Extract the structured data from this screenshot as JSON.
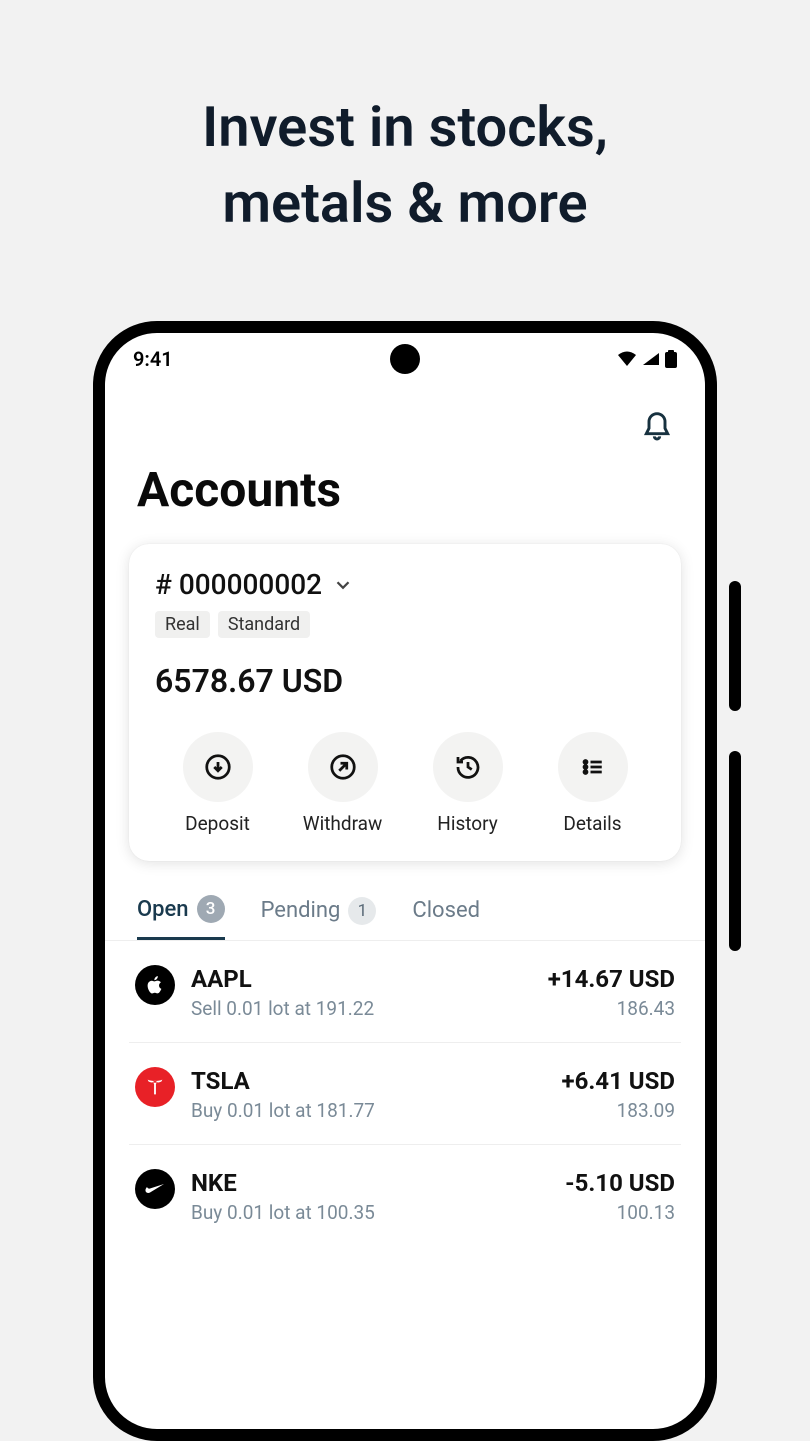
{
  "promo_title_line1": "Invest in stocks,",
  "promo_title_line2": "metals & more",
  "status": {
    "time": "9:41"
  },
  "header": {
    "title": "Accounts"
  },
  "account": {
    "number": "# 000000002",
    "tag_real": "Real",
    "tag_standard": "Standard",
    "balance": "6578.67 USD",
    "actions": {
      "deposit": "Deposit",
      "withdraw": "Withdraw",
      "history": "History",
      "details": "Details"
    }
  },
  "tabs": {
    "open": {
      "label": "Open",
      "count": "3"
    },
    "pending": {
      "label": "Pending",
      "count": "1"
    },
    "closed": {
      "label": "Closed"
    }
  },
  "positions": [
    {
      "symbol": "AAPL",
      "detail": "Sell 0.01 lot at 191.22",
      "pnl": "+14.67 USD",
      "price": "186.43",
      "icon": "apple",
      "bg": "#000"
    },
    {
      "symbol": "TSLA",
      "detail": "Buy 0.01 lot at 181.77",
      "pnl": "+6.41 USD",
      "price": "183.09",
      "icon": "tesla",
      "bg": "#e82127"
    },
    {
      "symbol": "NKE",
      "detail": "Buy 0.01 lot at 100.35",
      "pnl": "-5.10 USD",
      "price": "100.13",
      "icon": "nike",
      "bg": "#000"
    }
  ]
}
